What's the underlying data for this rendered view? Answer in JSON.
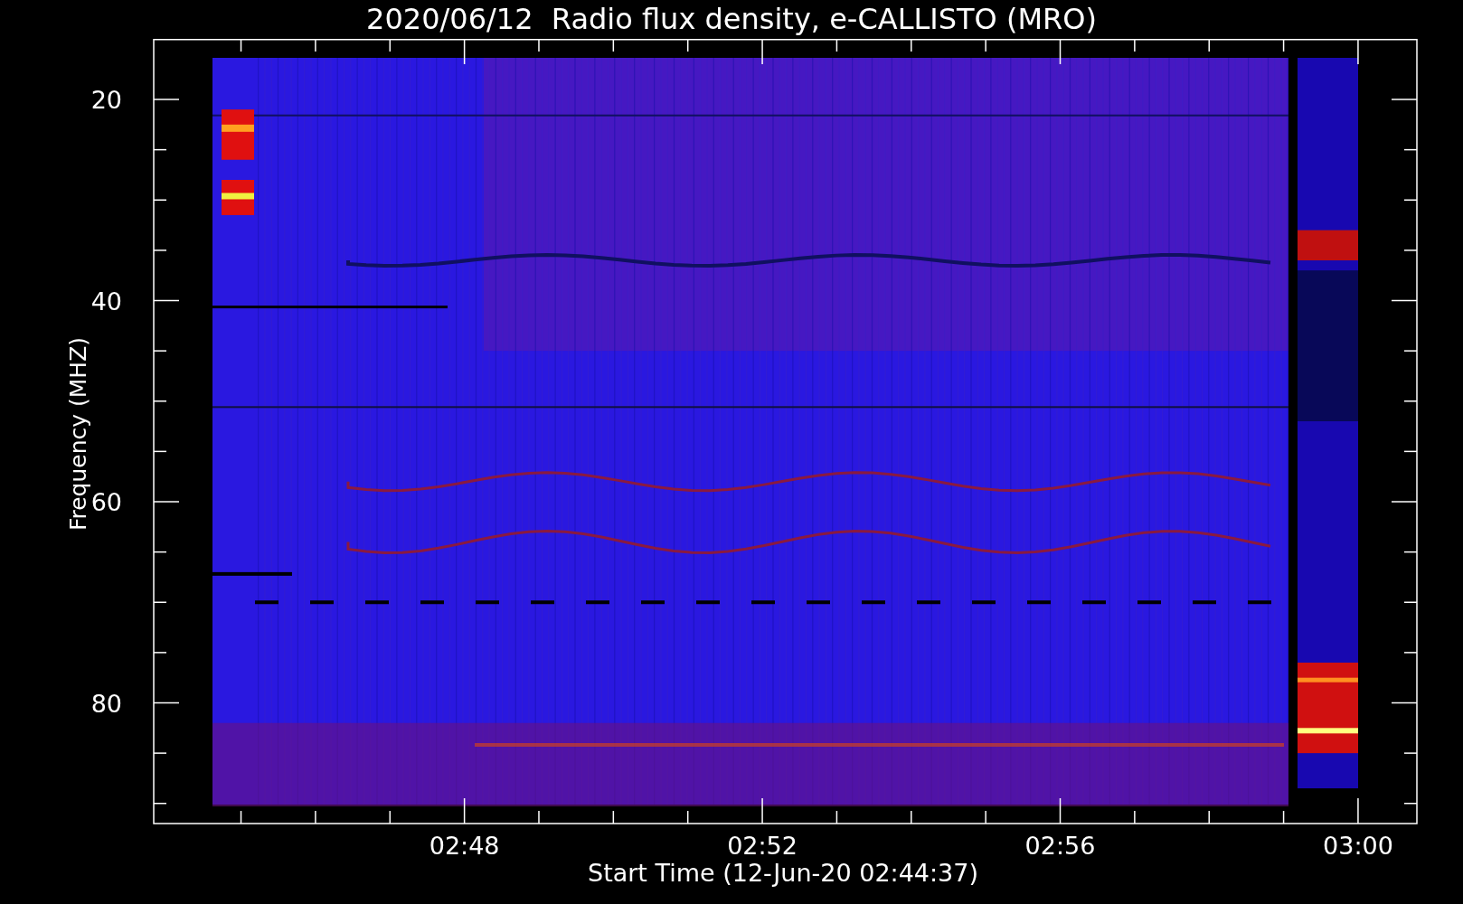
{
  "title": "2020/06/12  Radio flux density, e-CALLISTO (MRO)",
  "y_axis": {
    "label": "Frequency (MHZ)",
    "ticks": [
      "20",
      "40",
      "60",
      "80"
    ]
  },
  "x_axis": {
    "label": "Start Time (12-Jun-20 02:44:37)",
    "ticks": [
      "02:48",
      "02:52",
      "02:56",
      "03:00"
    ]
  }
}
